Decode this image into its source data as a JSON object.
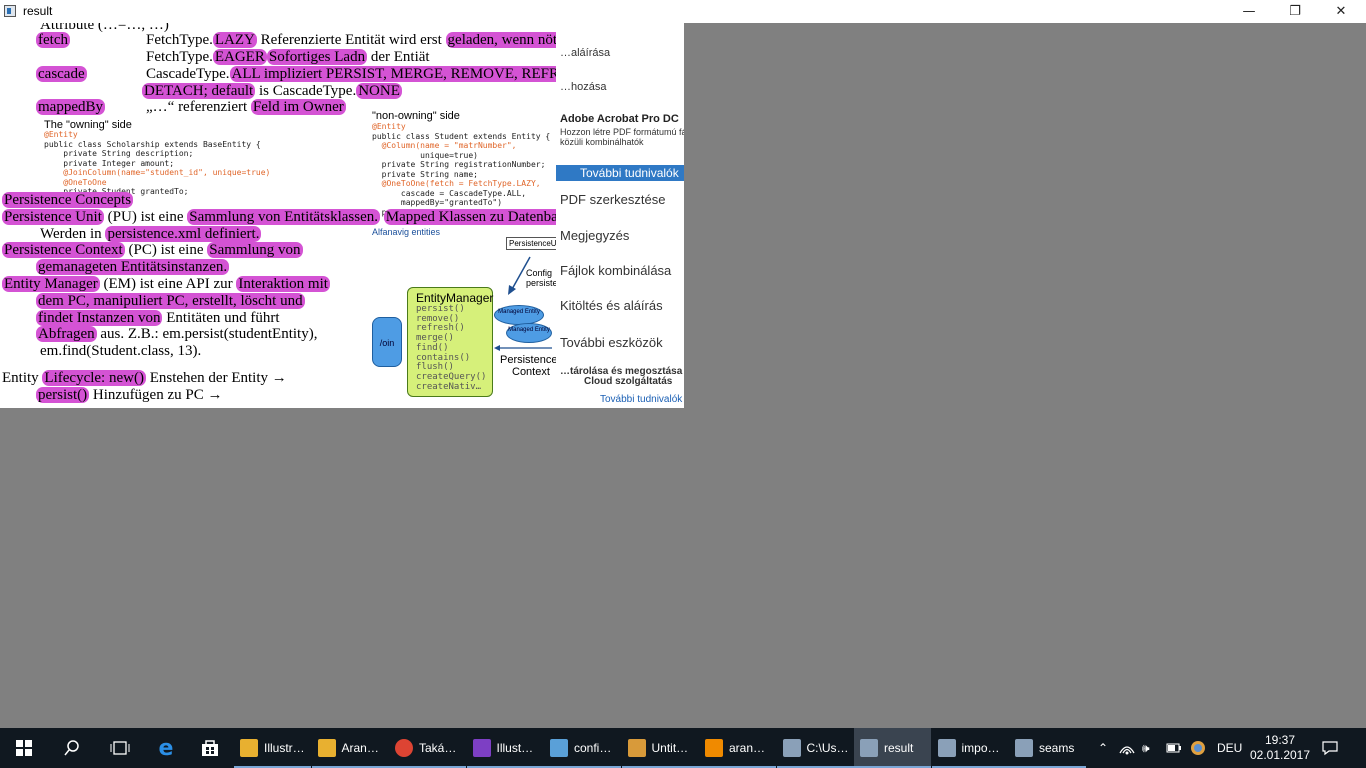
{
  "window": {
    "title": "result",
    "controls": {
      "minimize": "—",
      "maximize": "❐",
      "close": "✕"
    }
  },
  "slide": {
    "attribute_line": "Attribute (…=…, …)",
    "rows": [
      {
        "key": "fetch",
        "text_a": "FetchType.",
        "hl_a": "LAZY",
        "text_b": "Referenzierte Entität wird erst",
        "hl_b": "geladen, wenn nötig"
      },
      {
        "text_a": "FetchType.",
        "hl_a": "EAGER",
        "hl_b": "Sofortiges Ladn",
        "text_b": "der Entiät"
      },
      {
        "key": "cascade",
        "text_a": "CascadeType.",
        "hl_a": "ALL impliziert PERSIST, MERGE, REMOVE, REFRESH,",
        "hl_b": "DETACH; default",
        "text_b": "is CascadeType.",
        "hl_c": "NONE"
      },
      {
        "key": "mappedBy",
        "text_a": "„…“ referenziert",
        "hl_a": "Feld im Owner"
      }
    ],
    "owning_label": "The \"owning\" side",
    "owning_code": [
      "@Entity",
      "public class Scholarship extends BaseEntity {",
      "    private String description;",
      "    private Integer amount;",
      "    @JoinColumn(name=\"student_id\", unique=true)",
      "    @OneToOne",
      "    private Student grantedTo;"
    ],
    "non_owning_label": "\"non-owning\" side",
    "non_owning_code": [
      "@Entity",
      "public class Student extends Entity {",
      "  @Column(name = \"matrNumber\",",
      "          unique=true)",
      "  private String registrationNumber;",
      "  private String name;",
      "  @OneToOne(fetch = FetchType.LAZY,",
      "      cascade = CascadeType.ALL,",
      "      mappedBy=\"grantedTo\")",
      "  private Scholarship scholarship;"
    ],
    "concepts": {
      "heading": "Persistence Concepts",
      "pu_a": "Persistence Unit",
      "pu_b": "(PU) ist eine",
      "pu_hl": "Sammlung von Entitätsklassen.",
      "pu_hl2": "Mapped Klassen zu Datenbank.",
      "pu_line2_a": "Werden in",
      "pu_line2_hl": "persistence.xml definiert.",
      "pc_a": "Persistence Context",
      "pc_b": "(PC) ist eine",
      "pc_hl": "Sammlung von",
      "pc_line2_hl": "gemanageten Entitätsinstanzen.",
      "em_a": "Entity Manager",
      "em_b": "(EM) ist eine API zur",
      "em_hl": "Interaktion mit",
      "em_line2_hl": "dem PC, manipuliert PC, erstellt, löscht und",
      "em_line3_hl": "findet Instanzen von",
      "em_line3_b": "Entitäten und führt",
      "em_line4_hl": "Abfragen",
      "em_line4_b": "aus. Z.B.: em.persist(studentEntity),",
      "em_line5": "em.find(Student.class, 13).",
      "lc_a": "Entity",
      "lc_hl": "Lifecycle: new()",
      "lc_b": "Enstehen der Entity →",
      "lc_line2_hl": "persist()",
      "lc_line2_b": "Hinzufügen zu PC →"
    },
    "diagram": {
      "alfa_label": "Alfanavig entities",
      "persistence_unit_tag": "PersistenceUnit",
      "config_label": "Config persistence",
      "em_title": "EntityManager",
      "em_methods": [
        "persist()",
        "remove()",
        "refresh()",
        "merge()",
        "find()",
        "contains()",
        "flush()",
        "createQuery()",
        "createNativ…"
      ],
      "managed_a": "Managed Entity",
      "managed_b": "Managed Entity",
      "join_label": "/oin",
      "pc_label_a": "Persistence",
      "pc_label_b": "Context"
    }
  },
  "acrobat_panel": {
    "sign_label": "…aláírása",
    "share_label": "…hozása",
    "product": "Adobe Acrobat Pro DC",
    "desc_lines": [
      "Hozzon létre PDF formátumú fájlokat, és más fájltípusok",
      "közüli kombinálhatók"
    ],
    "more_info_button": "További tudnivalók",
    "tools": [
      "PDF szerkesztése",
      "Megjegyzés",
      "Fájlok kombinálása",
      "Kitöltés és aláírás",
      "További eszközök"
    ],
    "footer_a": "…tárolása és megosztása",
    "footer_b": "Cloud szolgáltatás",
    "footer_link": "További tudnivalók"
  },
  "taskbar": {
    "apps": [
      {
        "label": "Illustr…",
        "icon": "folder-icon",
        "color": "#e8b030"
      },
      {
        "label": "Aran…",
        "icon": "folder-icon",
        "color": "#e8b030"
      },
      {
        "label": "Taká…",
        "icon": "chrome-icon",
        "color": "#dd4433"
      },
      {
        "label": "Illust…",
        "icon": "visual-studio-icon",
        "color": "#7d3fc4"
      },
      {
        "label": "confi…",
        "icon": "notepad-icon",
        "color": "#5aa0d8"
      },
      {
        "label": "Untit…",
        "icon": "paint-icon",
        "color": "#d89a3a"
      },
      {
        "label": "aran…",
        "icon": "vlc-icon",
        "color": "#f08a00"
      },
      {
        "label": "C:\\Us…",
        "icon": "console-window-icon",
        "color": "#8aa0b8"
      },
      {
        "label": "result",
        "icon": "app-window-icon",
        "color": "#8aa0b8"
      },
      {
        "label": "impo…",
        "icon": "app-window-icon",
        "color": "#8aa0b8"
      },
      {
        "label": "seams",
        "icon": "app-window-icon",
        "color": "#8aa0b8"
      }
    ],
    "language": "DEU",
    "time": "19:37",
    "date": "02.01.2017"
  },
  "colors": {
    "highlight": "#d453d4",
    "desktop": "#808080",
    "taskbar": "#101820"
  }
}
